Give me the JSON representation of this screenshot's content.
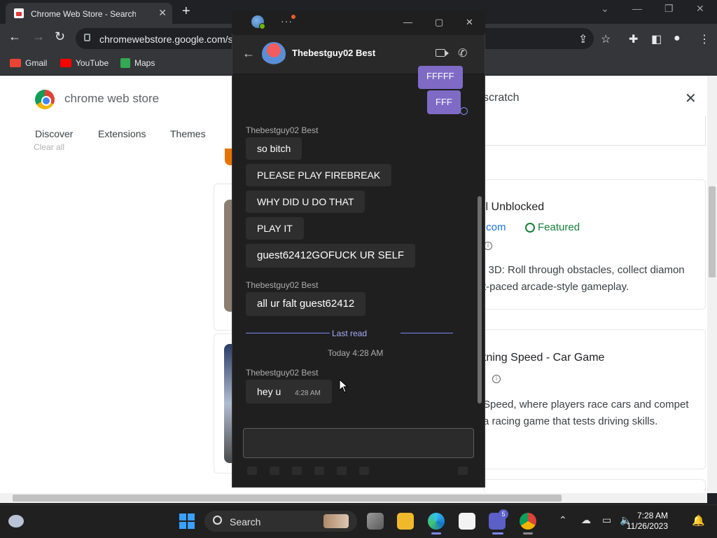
{
  "browser": {
    "tab_title": "Chrome Web Store - Search Res",
    "url": "chromewebstore.google.com/s",
    "bookmarks": [
      {
        "label": "Gmail",
        "icon": "gmail-icon",
        "color": "#ea4335"
      },
      {
        "label": "YouTube",
        "icon": "youtube-icon",
        "color": "#ff0000"
      },
      {
        "label": "Maps",
        "icon": "maps-icon",
        "color": "#34a853"
      }
    ]
  },
  "store": {
    "name": "chrome web store",
    "nav": [
      "Discover",
      "Extensions",
      "Themes"
    ],
    "clear_all": "Clear all",
    "search_term": "scratch",
    "results": [
      {
        "title": "ll Unblocked",
        "domain": ".com",
        "featured": "Featured",
        "desc_line1": "l 3D: Roll through obstacles, collect diamon",
        "desc_line2": "t-paced arcade-style gameplay."
      },
      {
        "title": "tning Speed - Car Game",
        "desc_line1": "Speed, where players race cars and compet",
        "desc_line2": "a racing game that tests driving skills."
      }
    ]
  },
  "chat": {
    "peer_name": "Thebestguy02 Best",
    "outgoing": [
      "FFFFF",
      "FFF"
    ],
    "groups": [
      {
        "sender": "Thebestguy02 Best",
        "messages": [
          "so bitch",
          "PLEASE PLAY FIREBREAK",
          "WHY DID U DO THAT",
          "PLAY IT",
          "guest62412GOFUCK UR SELF"
        ]
      },
      {
        "sender": "Thebestguy02 Best",
        "messages": [
          "all ur falt guest62412"
        ]
      }
    ],
    "last_read": "Last read",
    "date_separator": "Today 4:28 AM",
    "latest": {
      "sender": "Thebestguy02 Best",
      "message": "hey u",
      "time": "4:28 AM"
    },
    "accent": "#7f85f5",
    "outgoing_color": "#7f6bc6"
  },
  "taskbar": {
    "search_label": "Search",
    "teams_badge": "5",
    "time": "7:28 AM",
    "date": "11/26/2023"
  }
}
